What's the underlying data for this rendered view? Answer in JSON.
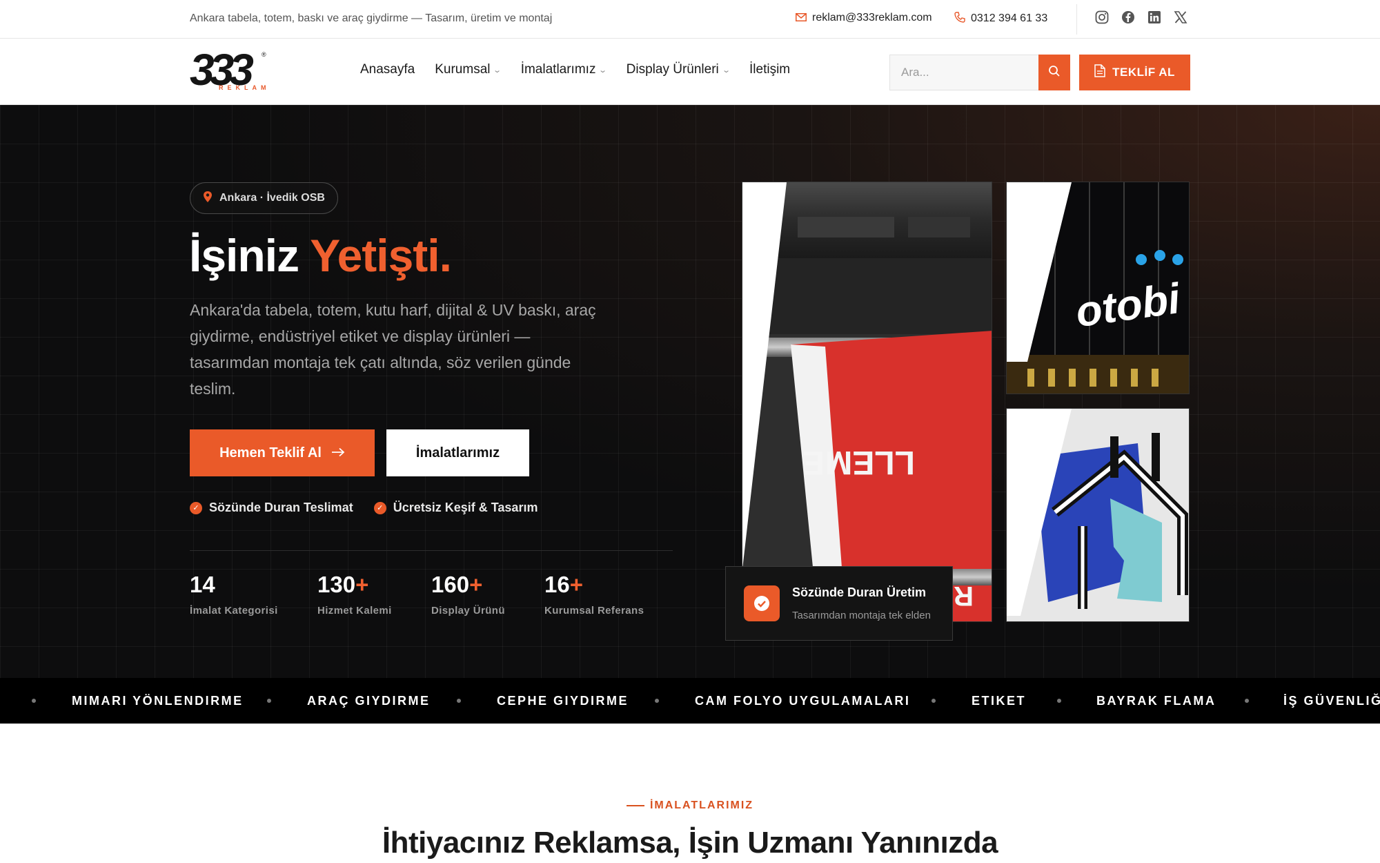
{
  "topbar": {
    "tagline": "Ankara tabela, totem, baskı ve araç giydirme — Tasarım, üretim ve montaj",
    "email": "reklam@333reklam.com",
    "phone": "0312 394 61 33",
    "social": [
      "instagram-icon",
      "facebook-icon",
      "linkedin-icon",
      "x-icon"
    ]
  },
  "logo": {
    "number": "333",
    "sub": "REKLAM",
    "mark": "®"
  },
  "nav": {
    "items": [
      {
        "label": "Anasayfa",
        "dropdown": false
      },
      {
        "label": "Kurumsal",
        "dropdown": true
      },
      {
        "label": "İmalatlarımız",
        "dropdown": true
      },
      {
        "label": "Display Ürünleri",
        "dropdown": true
      },
      {
        "label": "İletişim",
        "dropdown": false
      }
    ],
    "search_placeholder": "Ara...",
    "cta_label": "TEKLİF AL"
  },
  "hero": {
    "location": "Ankara · İvedik OSB",
    "title_main": "İşiniz ",
    "title_accent": "Yetişti.",
    "lead": "Ankara'da tabela, totem, kutu harf, dijital & UV baskı, araç giydirme, endüstriyel etiket ve display ürünleri — tasarımdan montaja tek çatı altında, söz verilen günde teslim.",
    "primary_button": "Hemen Teklif Al",
    "secondary_button": "İmalatlarımız",
    "badges": [
      "Sözünde Duran Teslimat",
      "Ücretsiz Keşif & Tasarım"
    ],
    "stats": [
      {
        "value": "14",
        "plus": "",
        "label": "İmalat Kategorisi"
      },
      {
        "value": "130",
        "plus": "+",
        "label": "Hizmet Kalemi"
      },
      {
        "value": "160",
        "plus": "+",
        "label": "Display Ürünü"
      },
      {
        "value": "16",
        "plus": "+",
        "label": "Kurumsal Referans"
      }
    ],
    "card_title": "Sözünde Duran Üretim",
    "card_subtitle": "Tasarımdan montaja tek elden",
    "image_texts": {
      "banner": "LLEME",
      "banner_lower": "RI",
      "sign": "otobi"
    },
    "accent_color": "#ea5a29"
  },
  "marquee": [
    "MIMARI YÖNLENDIRME",
    "ARAÇ GIYDIRME",
    "CEPHE GIYDIRME",
    "CAM FOLYO UYGULAMALARI",
    "ETIKET",
    "BAYRAK FLAMA",
    "İŞ GÜVENLIĞI"
  ],
  "section": {
    "kicker": "İMALATLARIMIZ",
    "title": "İhtiyacınız Reklamsa, İşin Uzmanı Yanınızda"
  }
}
